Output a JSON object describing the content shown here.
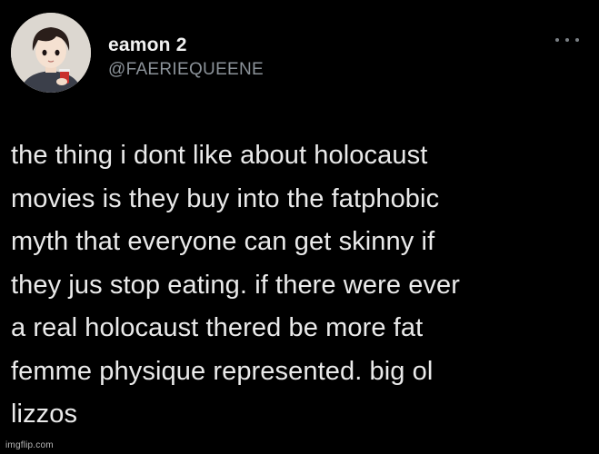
{
  "tweet": {
    "author": {
      "display_name": "eamon 2",
      "handle": "@FAERIEQUEENE",
      "avatar_icon": "profile-avatar-icon"
    },
    "more_icon": "more-options-icon",
    "text": "the thing i dont like about holocaust\nmovies is they buy into the fatphobic\nmyth that everyone can get skinny if\nthey jus stop eating. if there were ever\na real holocaust thered be more fat\nfemme physique represented. big ol\nlizzos"
  },
  "watermark": {
    "text": "imgflip.com"
  },
  "colors": {
    "background": "#000000",
    "text": "#eaeaea",
    "handle": "#8b9299"
  }
}
